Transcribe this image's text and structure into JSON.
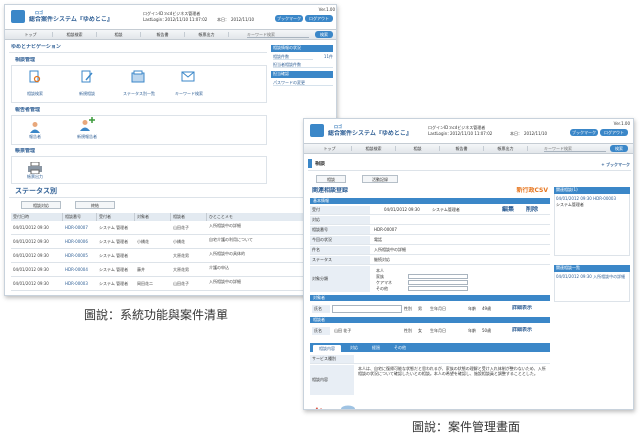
{
  "screen1": {
    "header": {
      "logo_badge": "ロゴ",
      "system_title": "総合案件システム『ゆめとこ』",
      "login_id_label": "ログインID：",
      "login_id_value": "ncdビジネス管理者",
      "last_login_label": "LastLogin：",
      "last_login_value": "2012/11/10 11:07:02",
      "date_label": "本日：",
      "date_value": "2012/11/10",
      "bookmark_button": "ブックマーク",
      "logout_button": "ログアウト",
      "version": "Ver.1.00"
    },
    "nav": [
      "トップ",
      "相談検索",
      "相談",
      "報告書",
      "帳票出力"
    ],
    "keyword_placeholder": "キーワード検索",
    "search_button": "検索",
    "page_title": "ゆめとナビゲーション",
    "sections": [
      {
        "title": "相談管理",
        "items": [
          "相談検索",
          "新規相談",
          "ステータス別一覧",
          "キーワード検索"
        ]
      },
      {
        "title": "報告者管理",
        "items": [
          "報告者",
          "新規報告者"
        ]
      },
      {
        "title": "帳票管理",
        "items": [
          "帳票出力"
        ]
      }
    ],
    "side_panel": {
      "head1": "相談情報の状況",
      "row1_label": "相談件数",
      "row1_value": "11件",
      "row2": "担当者相談件数",
      "head2": "担当確認",
      "row3": "パスワードの変更"
    },
    "status": {
      "title": "ステータス別",
      "tabs": [
        "相談対応",
        "終結"
      ],
      "columns": [
        "受付日時",
        "相談番号",
        "受付者",
        "対象者",
        "相談者",
        "ひとことメモ"
      ],
      "rows": [
        [
          "04/01/2012 09:30",
          "HDR-00007",
          "システム 管理者",
          "",
          "山田花子",
          "入所相談中の詳細"
        ],
        [
          "04/01/2012 09:30",
          "HDR-00006",
          "システム 管理者",
          "小橋花",
          "小橋花",
          "自宅介護の利用について"
        ],
        [
          "04/01/2012 09:30",
          "HDR-00005",
          "システム 管理者",
          "",
          "大原花男",
          "入所相談中の具体的"
        ],
        [
          "04/01/2012 09:30",
          "HDR-00004",
          "システム 管理者",
          "藤井",
          "大原花男",
          "介護の申込"
        ],
        [
          "04/01/2012 09:30",
          "HDR-00003",
          "システム 管理者",
          "岡田花二",
          "山田花子",
          "入所相談中の詳細"
        ]
      ]
    }
  },
  "screen2": {
    "header": {
      "logo_badge": "ロゴ",
      "system_title": "総合案件システム『ゆめとこ』",
      "login_id_label": "ログインID：",
      "login_id_value": "ncdビジネス管理者",
      "last_login_label": "LastLogin：",
      "last_login_value": "2012/11/10 11:07:02",
      "date_label": "本日：",
      "date_value": "2012/11/10",
      "bookmark_button": "ブックマーク",
      "logout_button": "ログアウト",
      "version": "Ver.1.00"
    },
    "nav": [
      "トップ",
      "相談検索",
      "相談",
      "報告書",
      "帳票出力"
    ],
    "keyword_placeholder": "キーワード検索",
    "search_button": "検索",
    "page_title": "相談",
    "bookmark_link": "+ ブックマーク",
    "subtabs": [
      "相談",
      "活動記録"
    ],
    "form_title": "関連相談登録",
    "csv_link": "新行政CSV",
    "section_basic": "基本情報",
    "fields": [
      "受付",
      "対応",
      "相談番号",
      "今回の状況",
      "件名",
      "ステータス",
      "対象分類"
    ],
    "accept_date": "04/01/2012 09:30",
    "accept_person": "システム管理者",
    "edit_link": "編集",
    "delete_link": "削除",
    "consult_no": "HDR-00007",
    "method": "電話",
    "subject": "入所相談中の詳細",
    "status_value": "継続対応",
    "radio_options": [
      "本人",
      "家族",
      "ケアマネ",
      "その他"
    ],
    "section_target": "対象者",
    "name_label": "氏名",
    "gender_label": "性別",
    "gender_value": "男",
    "birth_label": "生年月日",
    "age_label": "年齢",
    "age_value": "49歳",
    "detail_link": "詳細表示",
    "section_consultant": "相談者",
    "consultant_name": "山田 花子",
    "gender_value2": "女",
    "age_value2": "50歳",
    "detail_tabs": [
      "相談内容",
      "対応",
      "経過",
      "その他"
    ],
    "service_label": "サービス種別",
    "content_label": "相談内容",
    "content_text": "本人は、自宅に復帰可能な状態だと思われるが、家族の状態の理解と受け入れ体制が整わないため、入所相談の状況について確認したいとの相談。本人の希望を確認し、施設相談員と調整することとした。",
    "right_panel1": "関連相談(1)",
    "right_panel1_row": "04/01/2012 09:30 HDR-00003",
    "right_panel1_row2": "システム管理者",
    "right_panel2": "関連相談一覧",
    "right_panel2_row": "04/01/2012 09:30 入所相談中の詳細"
  },
  "captions": {
    "left": "圖說：系統功能與案件清單",
    "right": "圖說：案件管理畫面"
  },
  "colors": {
    "accent": "#3b87c8",
    "orange": "#e6731a",
    "link": "#2f5f95"
  }
}
